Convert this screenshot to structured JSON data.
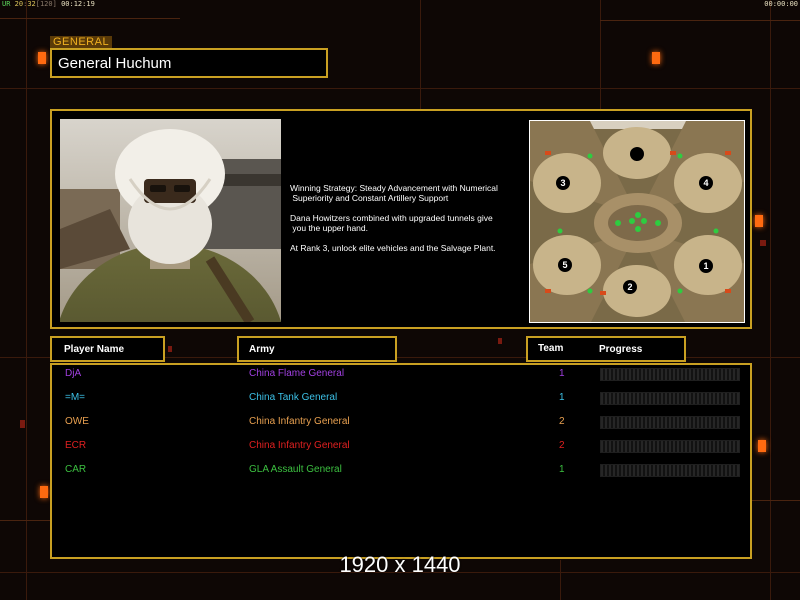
{
  "hud": {
    "left_labels": [
      "UR",
      "20",
      "32",
      "120",
      "00:12:19"
    ],
    "right_time": "00:00:00"
  },
  "general": {
    "tag": "GENERAL",
    "name": "General Huchum"
  },
  "strategy": {
    "paragraphs": [
      "Winning Strategy: Steady Advancement with Numerical\n Superiority and Constant Artillery Support",
      "Dana Howitzers combined with upgraded tunnels give\n you the upper hand.",
      "At Rank 3, unlock elite vehicles and the Salvage Plant."
    ]
  },
  "minimap": {
    "start_positions": [
      "1",
      "2",
      "3",
      "4",
      "5"
    ]
  },
  "columns": {
    "player_name": "Player Name",
    "army": "Army",
    "team": "Team",
    "progress": "Progress"
  },
  "players": [
    {
      "name": "DjA",
      "army": "China Flame General",
      "team": "1",
      "color": "#a040e0",
      "progress": 0
    },
    {
      "name": "=M=",
      "army": "China Tank General",
      "team": "1",
      "color": "#3cc0e6",
      "progress": 0
    },
    {
      "name": "OWE",
      "army": "China Infantry General",
      "team": "2",
      "color": "#e8a050",
      "progress": 0
    },
    {
      "name": "ECR",
      "army": "China Infantry General",
      "team": "2",
      "color": "#e02020",
      "progress": 0
    },
    {
      "name": "CAR",
      "army": "GLA Assault General",
      "team": "1",
      "color": "#3cc040",
      "progress": 0
    }
  ],
  "resolution_label": "1920 x 1440",
  "colors": {
    "accent_gold": "#c9a022",
    "accent_orange": "#ff6a10"
  }
}
